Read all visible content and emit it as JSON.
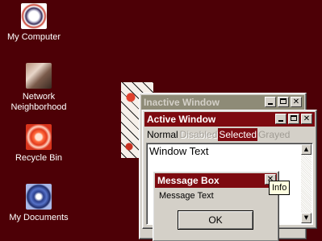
{
  "desktop": {
    "background_color": "#4d0006",
    "icons": [
      {
        "label": "My Computer",
        "icon": "my-computer-icon"
      },
      {
        "label": "Network Neighborhood",
        "icon": "network-neighborhood-icon"
      },
      {
        "label": "Recycle Bin",
        "icon": "recycle-bin-icon"
      },
      {
        "label": "My Documents",
        "icon": "my-documents-icon"
      }
    ]
  },
  "inactive_window": {
    "title": "Inactive Window",
    "title_color": "#8e8b77"
  },
  "active_window": {
    "title": "Active Window",
    "title_color": "#7d0a10",
    "menu": {
      "normal": "Normal",
      "disabled": "Disabled",
      "selected": "Selected",
      "grayed": "Grayed"
    },
    "window_text": "Window Text"
  },
  "message_box": {
    "title": "Message Box",
    "text": "Message Text",
    "ok_label": "OK",
    "close_glyph": "✕"
  },
  "tooltip": {
    "text": "Info"
  },
  "controls": {
    "close_glyph": "✕",
    "scroll_up_glyph": "▲",
    "scroll_down_glyph": "▼"
  }
}
